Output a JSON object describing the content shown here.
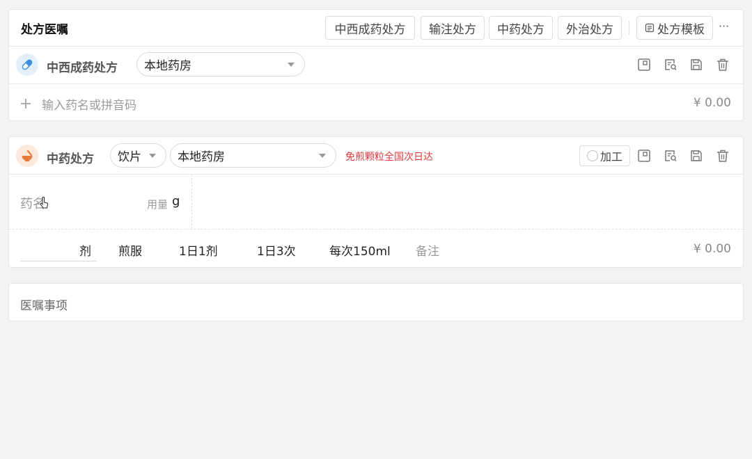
{
  "header": {
    "title": "处方医嘱",
    "tabs": [
      "中西成药处方",
      "输注处方",
      "中药处方",
      "外治处方"
    ],
    "template_label": "处方模板",
    "more_label": "···"
  },
  "western": {
    "label": "中西成药处方",
    "pharmacy": "本地药房",
    "add_placeholder": "输入药名或拼音码",
    "price": "¥ 0.00"
  },
  "chinese": {
    "label": "中药处方",
    "form": "饮片",
    "pharmacy": "本地药房",
    "promo": "免煎颗粒全国次日达",
    "process_label": "加工",
    "drug_placeholder": "药名",
    "dose_label": "用量",
    "dose_unit": "g",
    "doses_unit": "剂",
    "usage": "煎服",
    "freq_day": "1日1剂",
    "freq_times": "1日3次",
    "per_amount": "每次150ml",
    "remark_placeholder": "备注",
    "price": "¥ 0.00"
  },
  "advice": {
    "label": "医嘱事项"
  },
  "colors": {
    "accent_blue": "#3d8fe0",
    "accent_orange": "#e57c3a",
    "promo_red": "#e0393e"
  }
}
